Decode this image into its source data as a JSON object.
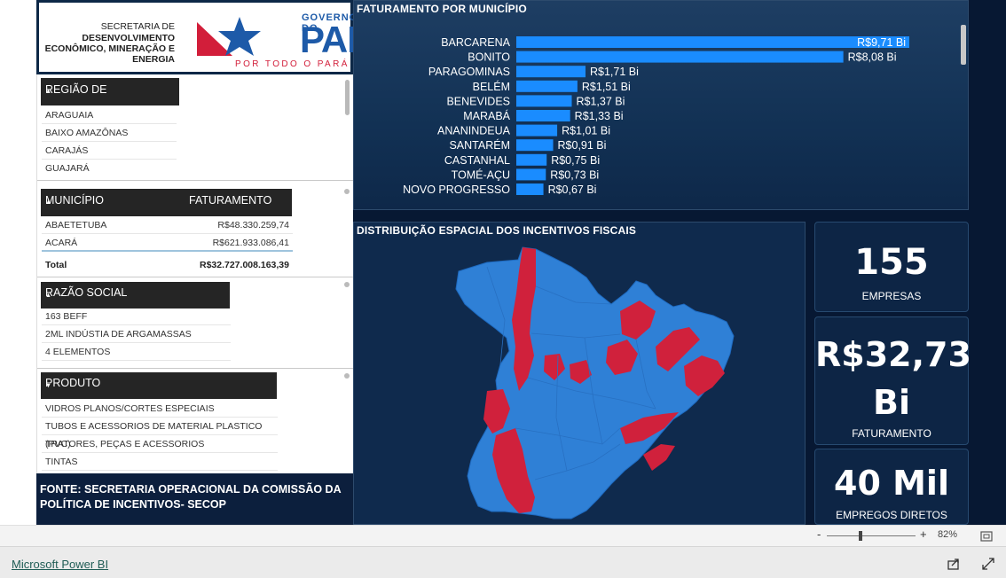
{
  "logo": {
    "sec_line1": "SECRETARIA DE",
    "sec_line2": "DESENVOLVIMENTO",
    "sec_line3": "ECONÔMICO, MINERAÇÃO E",
    "sec_line4": "ENERGIA",
    "gov_label": "GOVERNO DO",
    "para_label": "PARÁ",
    "slogan": "POR TODO O PARÁ",
    "colors": {
      "blue": "#1d5aa8",
      "red": "#d21e3a"
    }
  },
  "regiao": {
    "header": "REGIÃO DE INTEGRAÇÃO",
    "items": [
      "ARAGUAIA",
      "BAIXO AMAZÔNAS",
      "CARAJÁS",
      "GUAJARÁ"
    ]
  },
  "municipio_table": {
    "col1": "MUNICÍPIO",
    "col2": "FATURAMENTO",
    "rows": [
      {
        "name": "ABAETETUBA",
        "value": "R$48.330.259,74"
      },
      {
        "name": "ACARÁ",
        "value": "R$621.933.086,41"
      }
    ],
    "total_label": "Total",
    "total_value": "R$32.727.008.163,39"
  },
  "razao": {
    "header": "RAZÃO SOCIAL",
    "items": [
      "163 BEFF",
      "2ML INDÚSTIA DE ARGAMASSAS",
      "4 ELEMENTOS"
    ]
  },
  "produto": {
    "header": "PRODUTO",
    "items": [
      "VIDROS PLANOS/CORTES ESPECIAIS",
      "TUBOS E ACESSORIOS DE MATERIAL PLASTICO (PVC)",
      "TRATORES, PEÇAS E ACESSORIOS",
      "TINTAS"
    ]
  },
  "fonte": "FONTE: SECRETARIA OPERACIONAL DA COMISSÃO DA POLÍTICA DE INCENTIVOS- SECOP",
  "chart_data": {
    "type": "bar",
    "title": "FATURAMENTO POR MUNICÍPIO",
    "orientation": "horizontal",
    "categories": [
      "BARCARENA",
      "BONITO",
      "PARAGOMINAS",
      "BELÉM",
      "BENEVIDES",
      "MARABÁ",
      "ANANINDEUA",
      "SANTARÉM",
      "CASTANHAL",
      "TOMÉ-AÇU",
      "NOVO PROGRESSO"
    ],
    "values": [
      9.71,
      8.08,
      1.71,
      1.51,
      1.37,
      1.33,
      1.01,
      0.91,
      0.75,
      0.73,
      0.67
    ],
    "data_labels": [
      "R$9,71 Bi",
      "R$8,08 Bi",
      "R$1,71 Bi",
      "R$1,51 Bi",
      "R$1,37 Bi",
      "R$1,33 Bi",
      "R$1,01 Bi",
      "R$0,91 Bi",
      "R$0,75 Bi",
      "R$0,73 Bi",
      "R$0,67 Bi"
    ],
    "bar_color": "#1a8cff",
    "xlim": [
      0,
      9.71
    ]
  },
  "map": {
    "title": "DISTRIBUIÇÃO ESPACIAL DOS INCENTIVOS FISCAIS",
    "colors": {
      "base": "#2f80d6",
      "highlight": "#d0213c"
    }
  },
  "kpis": [
    {
      "value_line1": "155",
      "value_line2": "",
      "label": "EMPRESAS"
    },
    {
      "value_line1": "R$32,73",
      "value_line2": "Bi",
      "label": "FATURAMENTO"
    },
    {
      "value_line1": "40 Mil",
      "value_line2": "",
      "label": "EMPREGOS DIRETOS"
    }
  ],
  "zoom": {
    "minus": "-",
    "plus": "+",
    "level": "82%"
  },
  "footer": {
    "link": "Microsoft Power BI"
  }
}
